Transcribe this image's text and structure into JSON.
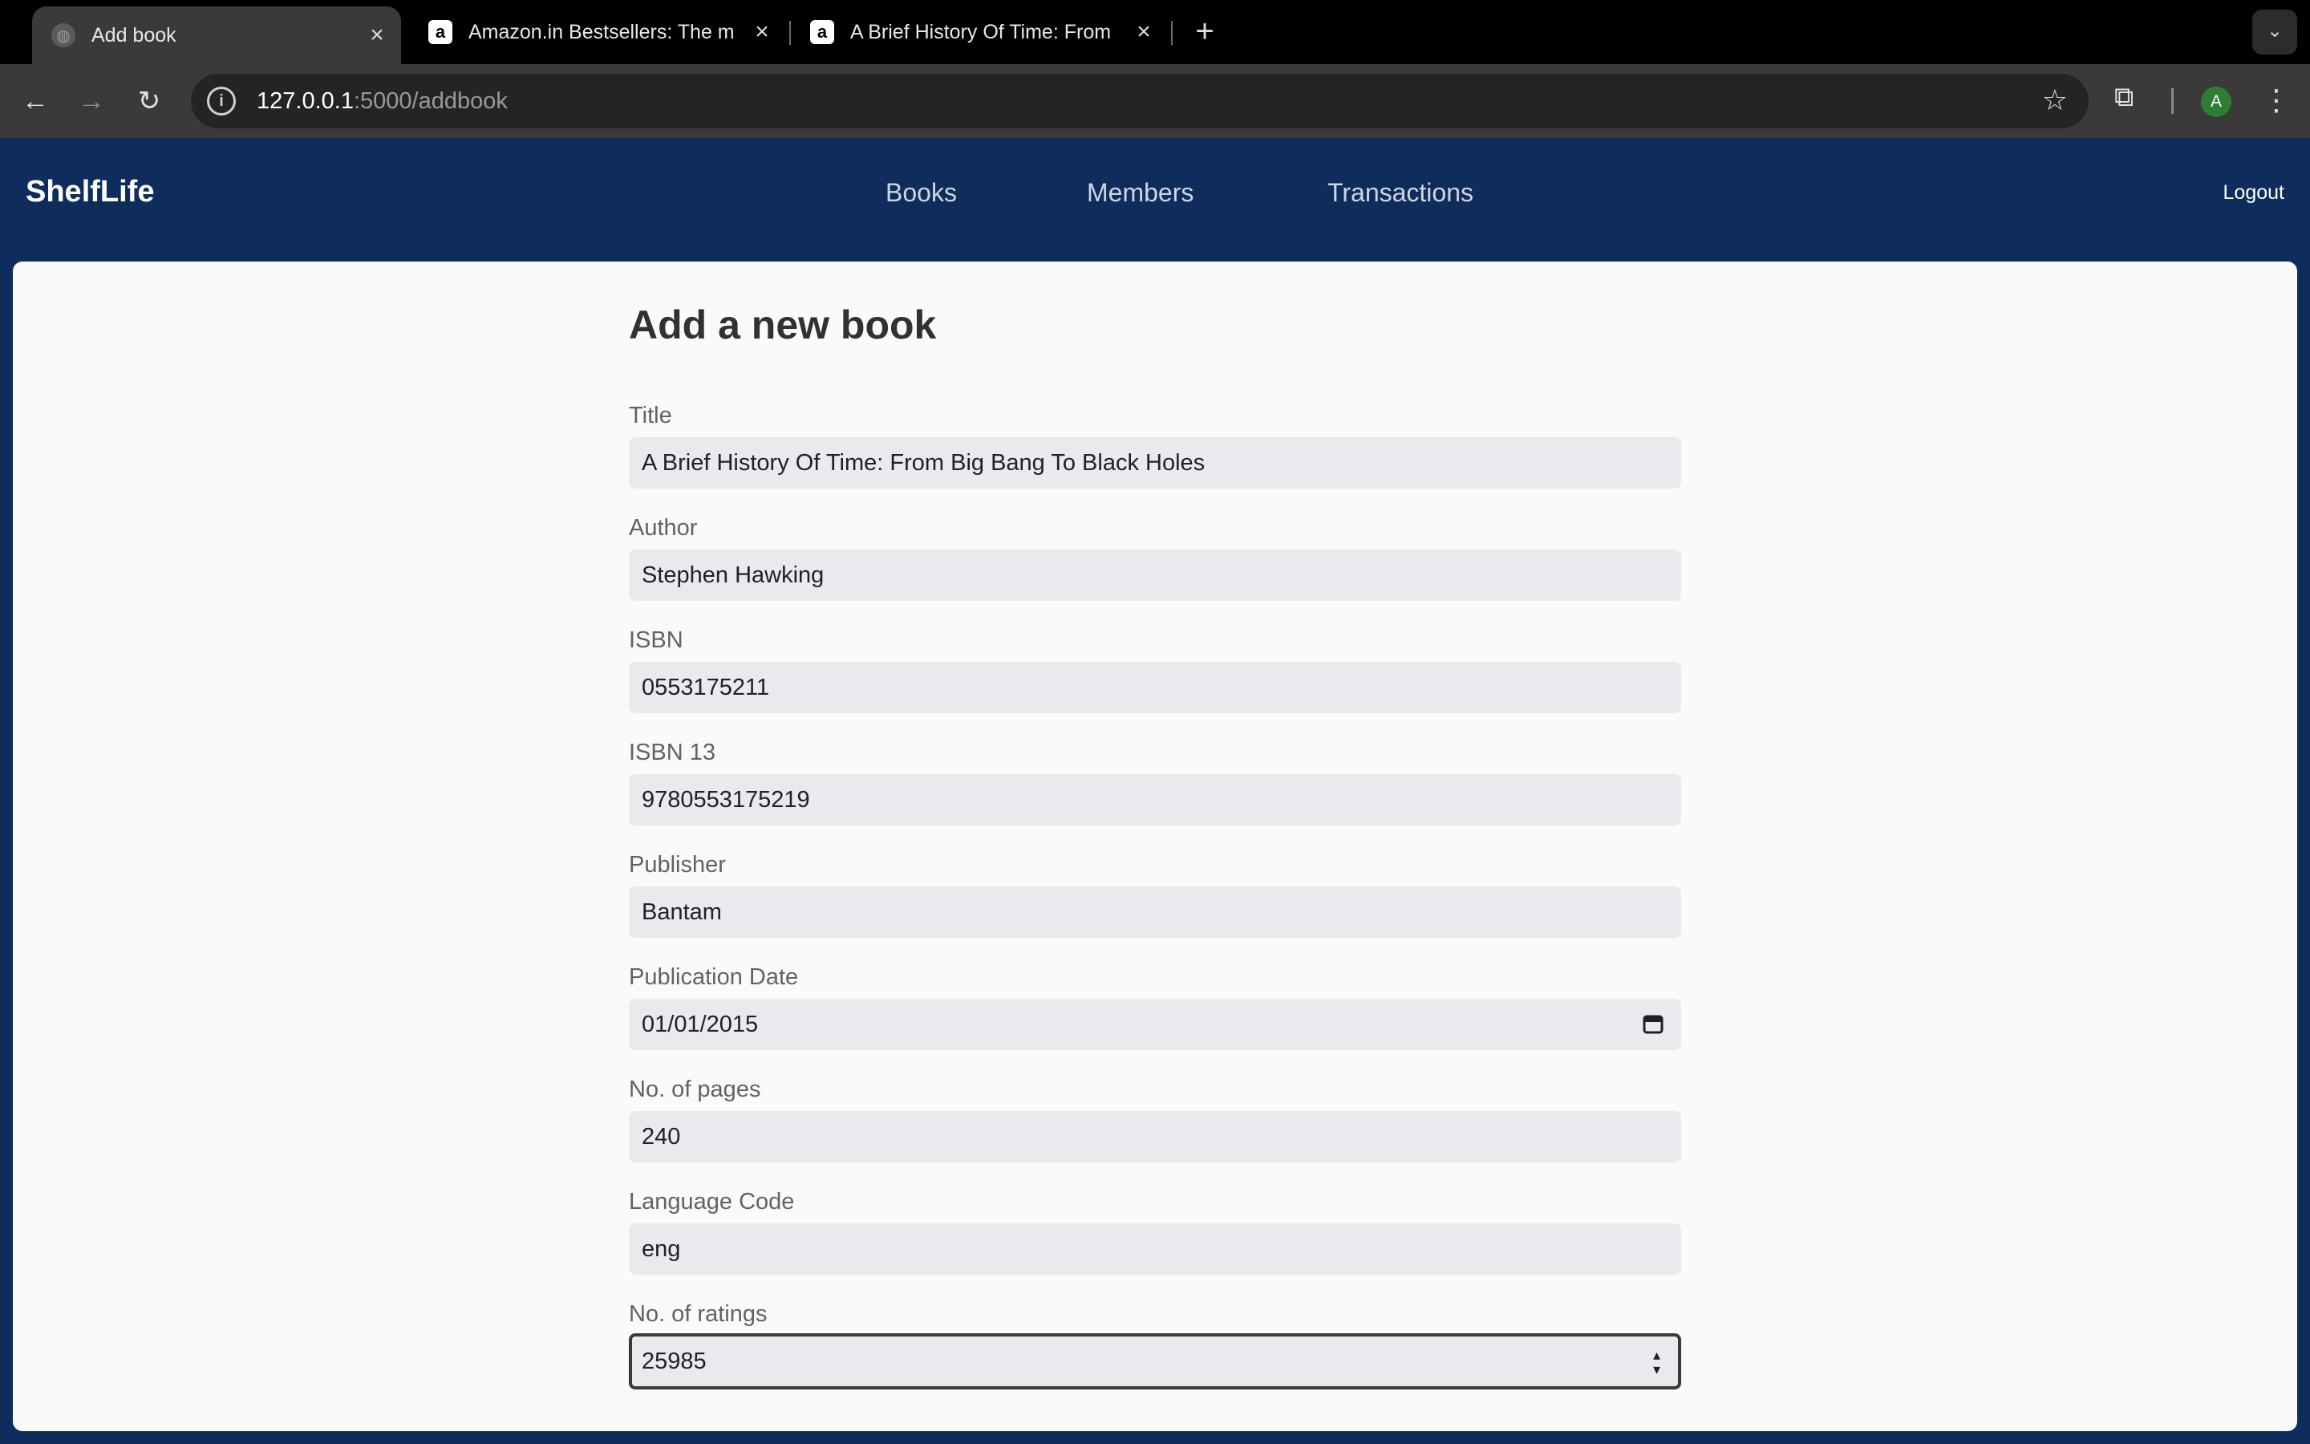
{
  "browser": {
    "tabs": [
      {
        "title": "Add book",
        "favicon": "globe-icon",
        "active": true
      },
      {
        "title": "Amazon.in Bestsellers: The m",
        "favicon": "amazon-icon",
        "active": false
      },
      {
        "title": "A Brief History Of Time: From",
        "favicon": "amazon-icon",
        "active": false
      }
    ],
    "url_host": "127.0.0.1",
    "url_path": ":5000/addbook",
    "profile_initial": "A"
  },
  "app": {
    "brand": "ShelfLife",
    "nav": [
      "Books",
      "Members",
      "Transactions"
    ],
    "logout": "Logout"
  },
  "form": {
    "title": "Add a new book",
    "fields": [
      {
        "label": "Title",
        "value": "A Brief History Of Time: From Big Bang To Black Holes"
      },
      {
        "label": "Author",
        "value": "Stephen Hawking"
      },
      {
        "label": "ISBN",
        "value": "0553175211"
      },
      {
        "label": "ISBN 13",
        "value": "9780553175219"
      },
      {
        "label": "Publisher",
        "value": "Bantam"
      },
      {
        "label": "Publication Date",
        "value": "01/01/2015"
      },
      {
        "label": "No. of pages",
        "value": "240"
      },
      {
        "label": "Language Code",
        "value": "eng"
      },
      {
        "label": "No. of ratings",
        "value": "25985"
      }
    ]
  }
}
